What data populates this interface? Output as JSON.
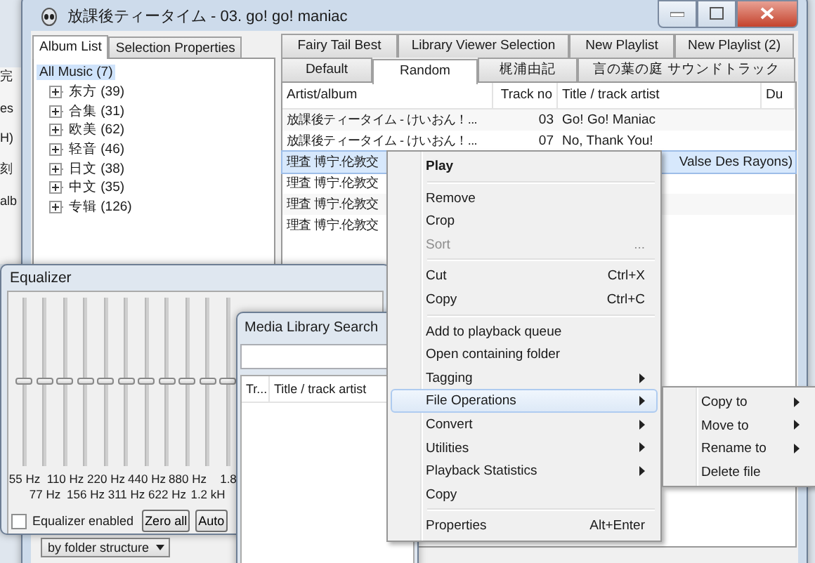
{
  "background_window": {
    "texts": [
      "完",
      "es",
      "H)",
      "刻",
      "alb"
    ]
  },
  "main_window": {
    "title": "放課後ティータイム - 03. go! go! maniac",
    "left_tabs": [
      {
        "label": "Album List",
        "selected": true
      },
      {
        "label": "Selection Properties",
        "selected": false
      }
    ],
    "tree": [
      {
        "label": "All Music (7)",
        "selected": true,
        "children": [
          {
            "label": "东方 (39)",
            "expanded": false,
            "selected": false
          },
          {
            "label": "合集 (31)",
            "expanded": false,
            "selected": false
          },
          {
            "label": "欧美 (62)",
            "expanded": false,
            "selected": false
          },
          {
            "label": "轻音 (46)",
            "expanded": false,
            "selected": false
          },
          {
            "label": "日文 (38)",
            "expanded": false,
            "selected": false
          },
          {
            "label": "中文 (35)",
            "expanded": false,
            "selected": false
          },
          {
            "label": "专辑 (126)",
            "expanded": false,
            "selected": false
          }
        ]
      }
    ],
    "view_dropdown": {
      "value": "by folder structure"
    },
    "playlist_tab_rows": [
      [
        {
          "label": "Fairy Tail Best",
          "selected": false
        },
        {
          "label": "Library Viewer Selection",
          "selected": false
        },
        {
          "label": "New Playlist",
          "selected": false
        },
        {
          "label": "New Playlist (2)",
          "selected": false
        }
      ],
      [
        {
          "label": "Default",
          "selected": false
        },
        {
          "label": "Random",
          "selected": true
        },
        {
          "label": "梶浦由記",
          "selected": false
        },
        {
          "label": "言の葉の庭 サウンドトラック",
          "selected": false
        }
      ]
    ],
    "playlist": {
      "columns": [
        "Artist/album",
        "Track no",
        "Title / track artist",
        "Du"
      ],
      "rows": [
        {
          "artist": "放課後ティータイム - けいおん！...",
          "track": "03",
          "title": "Go! Go! Maniac",
          "selected": false
        },
        {
          "artist": "放課後ティータイム - けいおん！...",
          "track": "07",
          "title": "No, Thank You!",
          "selected": false
        },
        {
          "artist": "理査 博宁.伦敦交",
          "title": "Valse Des Rayons)",
          "partial": true,
          "selected": true
        },
        {
          "artist": "理査 博宁.伦敦交",
          "selected": false
        },
        {
          "artist": "理査 博宁.伦敦交",
          "selected": false
        },
        {
          "artist": "理査 博宁.伦敦交",
          "selected": false
        }
      ]
    }
  },
  "equalizer": {
    "title": "Equalizer",
    "sliders": [
      {
        "level": 0.5
      },
      {
        "level": 0.5
      },
      {
        "level": 0.5
      },
      {
        "level": 0.5
      },
      {
        "level": 0.5
      },
      {
        "level": 0.5
      },
      {
        "level": 0.5
      },
      {
        "level": 0.5
      },
      {
        "level": 0.5
      },
      {
        "level": 0.5
      },
      {
        "level": 0.5
      }
    ],
    "labels_upper": [
      "55 Hz",
      "110 Hz",
      "220 Hz",
      "440 Hz",
      "880 Hz",
      "1.8"
    ],
    "labels_lower": [
      "77 Hz",
      "156 Hz",
      "311 Hz",
      "622 Hz",
      "1.2 kH"
    ],
    "enabled": {
      "label": "Equalizer enabled",
      "checked": false
    },
    "buttons": [
      "Zero all",
      "Auto"
    ]
  },
  "search_window": {
    "title": "Media Library Search",
    "columns": [
      "Tr...",
      "Title / track artist"
    ]
  },
  "context_menu": {
    "items": [
      {
        "kind": "item",
        "label": "Play",
        "default": true,
        "selected": false
      },
      {
        "kind": "separator"
      },
      {
        "kind": "item",
        "label": "Remove",
        "selected": false
      },
      {
        "kind": "item",
        "label": "Crop",
        "selected": false
      },
      {
        "kind": "item",
        "label": "Sort",
        "shortcut": "...",
        "disabled": true,
        "selected": false
      },
      {
        "kind": "separator"
      },
      {
        "kind": "item",
        "label": "Cut",
        "shortcut": "Ctrl+X",
        "selected": false
      },
      {
        "kind": "item",
        "label": "Copy",
        "shortcut": "Ctrl+C",
        "selected": false
      },
      {
        "kind": "separator"
      },
      {
        "kind": "item",
        "label": "Add to playback queue",
        "selected": false
      },
      {
        "kind": "item",
        "label": "Open containing folder",
        "selected": false
      },
      {
        "kind": "item",
        "label": "Tagging",
        "submenu": true,
        "selected": false
      },
      {
        "kind": "item",
        "label": "File Operations",
        "submenu": true,
        "selected": true
      },
      {
        "kind": "item",
        "label": "Convert",
        "submenu": true,
        "selected": false
      },
      {
        "kind": "item",
        "label": "Utilities",
        "submenu": true,
        "selected": false
      },
      {
        "kind": "item",
        "label": "Playback Statistics",
        "submenu": true,
        "selected": false
      },
      {
        "kind": "item",
        "label": "Copy",
        "selected": false
      },
      {
        "kind": "separator"
      },
      {
        "kind": "item",
        "label": "Properties",
        "shortcut": "Alt+Enter",
        "selected": false
      }
    ],
    "submenu": [
      {
        "kind": "item",
        "label": "Copy to",
        "submenu": true,
        "selected": false
      },
      {
        "kind": "item",
        "label": "Move to",
        "submenu": true,
        "selected": false
      },
      {
        "kind": "item",
        "label": "Rename to",
        "submenu": true,
        "selected": false
      },
      {
        "kind": "item",
        "label": "Delete file",
        "selected": false
      }
    ]
  }
}
